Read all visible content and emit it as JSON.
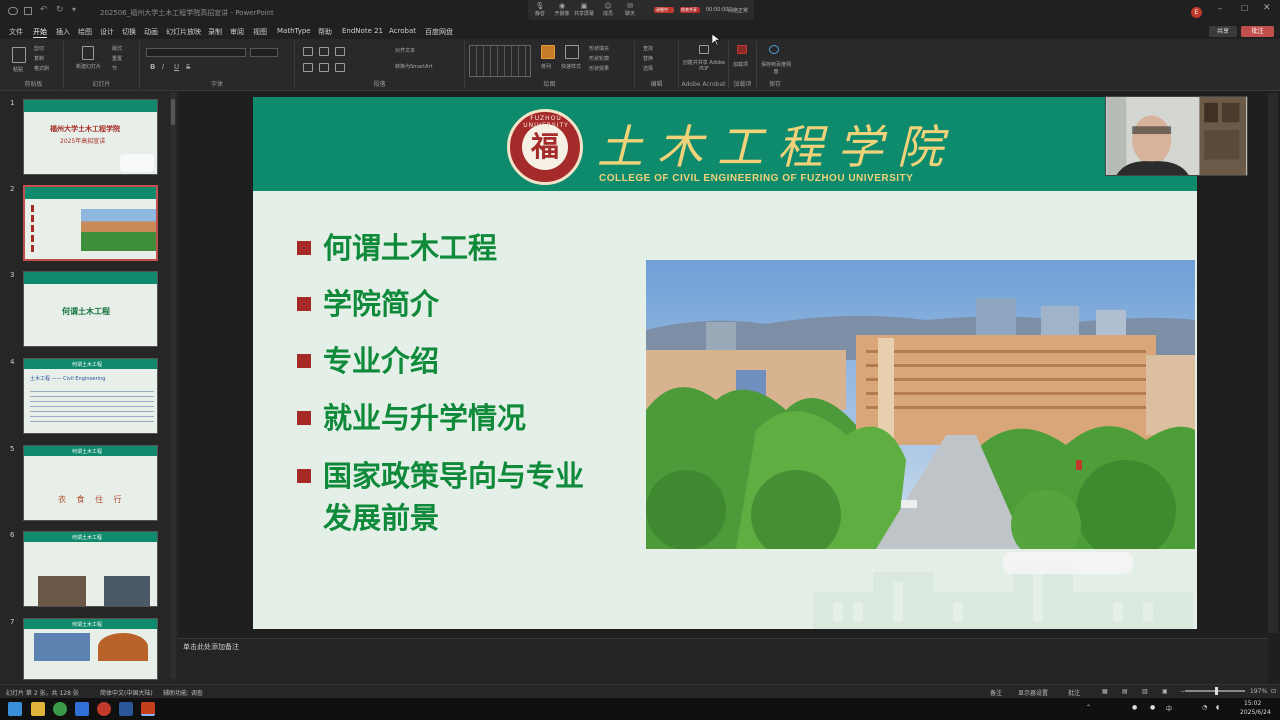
{
  "window": {
    "title": "202506_福州大学土木工程学院高招宣讲 - PowerPoint"
  },
  "meeting_bar": {
    "buttons": [
      "静音",
      "开摄像",
      "共享屏幕",
      "成员",
      "聊天",
      "应用"
    ],
    "recording": "录制中",
    "stop": "结束共享",
    "timer": "00:00:00",
    "extra": "网络正常"
  },
  "menu": {
    "items": [
      "文件",
      "开始",
      "插入",
      "绘图",
      "设计",
      "切换",
      "动画",
      "幻灯片放映",
      "录制",
      "审阅",
      "视图",
      "MathType",
      "帮助",
      "EndNote 21",
      "Acrobat",
      "百度网盘"
    ],
    "active_index": 1,
    "share": "共享",
    "comment": "批注"
  },
  "ribbon": {
    "groups": [
      {
        "label": "剪贴板",
        "buttons": [
          "粘贴",
          "剪切",
          "复制",
          "格式刷"
        ]
      },
      {
        "label": "幻灯片",
        "buttons": [
          "新建幻灯片",
          "版式",
          "重置",
          "节"
        ]
      },
      {
        "label": "字体",
        "buttons": [
          "B",
          "I",
          "U",
          "S"
        ]
      },
      {
        "label": "段落",
        "buttons": [
          "对齐文本",
          "转换为SmartArt"
        ]
      },
      {
        "label": "绘图",
        "buttons": [
          "排列",
          "快速样式",
          "形状填充",
          "形状轮廓",
          "形状效果"
        ]
      },
      {
        "label": "编辑",
        "buttons": [
          "查找",
          "替换",
          "选择"
        ]
      },
      {
        "label": "Adobe Acrobat",
        "buttons": [
          "创建并共享 Adobe PDF"
        ]
      },
      {
        "label": "加载项",
        "buttons": [
          "加载项"
        ]
      },
      {
        "label": "保存",
        "buttons": [
          "保存到百度网盘"
        ]
      }
    ]
  },
  "thumbnails": [
    {
      "num": "1",
      "title": "福州大学土木工程学院",
      "subtitle": "2025年高招宣讲"
    },
    {
      "num": "2",
      "title": "",
      "subtitle": "",
      "selected": true
    },
    {
      "num": "3",
      "title": "何谓土木工程",
      "subtitle": ""
    },
    {
      "num": "4",
      "title": "何谓土木工程",
      "subtitle": "土木工程 —— Civil Engineering"
    },
    {
      "num": "5",
      "title": "何谓土木工程",
      "subtitle": "衣 食 住 行"
    },
    {
      "num": "6",
      "title": "何谓土木工程",
      "subtitle": ""
    },
    {
      "num": "7",
      "title": "何谓土木工程",
      "subtitle": ""
    }
  ],
  "slide": {
    "logo_char": "福",
    "logo_ring": "FUZHOU UNIVERSITY",
    "college_cn": "土木工程学院",
    "college_en": "COLLEGE OF CIVIL ENGINEERING OF FUZHOU  UNIVERSITY",
    "bullets": [
      {
        "text": "何谓土木工程"
      },
      {
        "text": "学院简介"
      },
      {
        "text": "专业介绍"
      },
      {
        "text": "就业与升学情况"
      },
      {
        "text": "国家政策导向与专业"
      },
      {
        "text": "发展前景",
        "continuation": true
      }
    ],
    "accent_color": "#0e8a6c",
    "bullet_color": "#a52a24",
    "text_color": "#0f8a3a"
  },
  "notes": {
    "placeholder": "单击此处添加备注"
  },
  "status": {
    "slide_info": "幻灯片 第 2 张，共 128 张",
    "language": "简体中文(中国大陆)",
    "accessibility": "辅助功能: 调查",
    "notes_btn": "备注",
    "display_btn": "显示器设置",
    "comments_btn": "批注",
    "zoom": "197%"
  },
  "taskbar": {
    "time": "15:02",
    "date": "2025/6/24",
    "input": "中"
  }
}
